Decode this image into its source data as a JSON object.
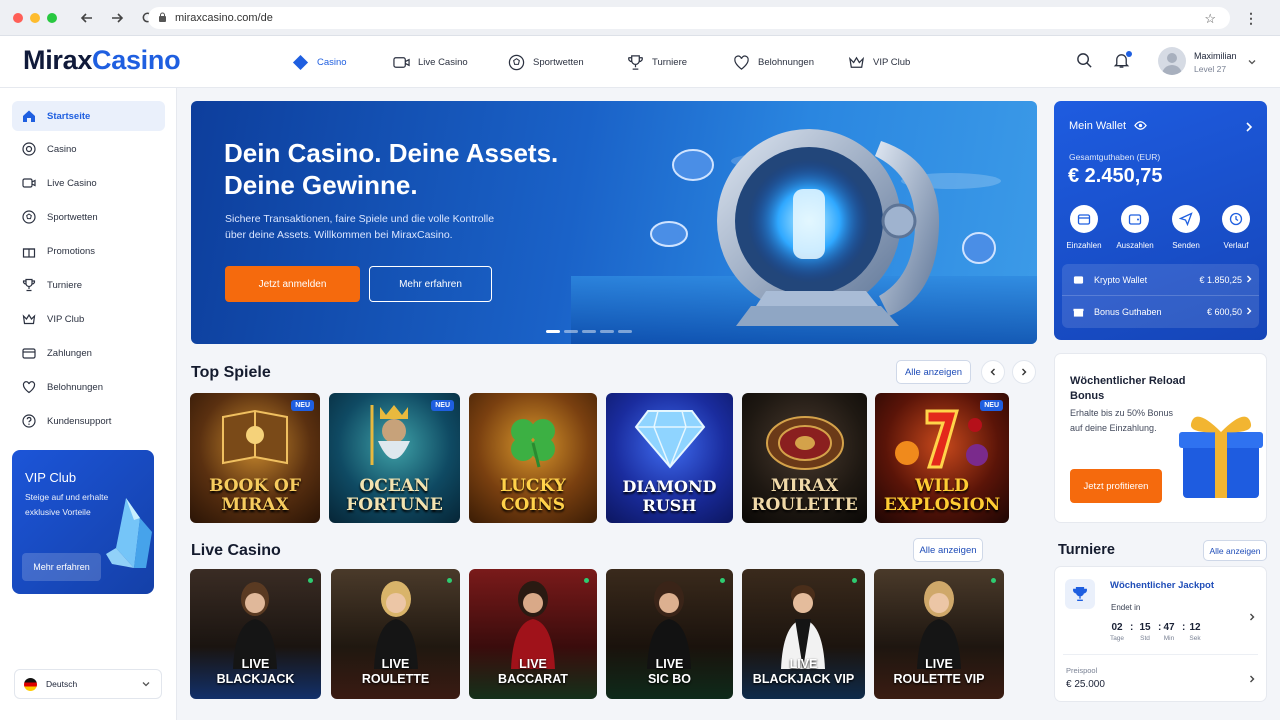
{
  "browser": {
    "url": "miraxcasino.com/de"
  },
  "brand": {
    "part1": "Mirax",
    "part2": "Casino"
  },
  "topnav": [
    {
      "label": "Casino",
      "icon": "casino-icon",
      "active": true
    },
    {
      "label": "Live Casino",
      "icon": "live-icon"
    },
    {
      "label": "Sportwetten",
      "icon": "ball-icon"
    },
    {
      "label": "Turniere",
      "icon": "trophy-icon"
    },
    {
      "label": "Belohnungen",
      "icon": "heart-icon"
    },
    {
      "label": "VIP Club",
      "icon": "crown-icon"
    }
  ],
  "user": {
    "name": "Maximilian",
    "level": "Level 27"
  },
  "sidebar": {
    "items": [
      {
        "label": "Startseite",
        "icon": "home-icon",
        "active": true
      },
      {
        "label": "Casino",
        "icon": "chip-icon"
      },
      {
        "label": "Live Casino",
        "icon": "live-icon"
      },
      {
        "label": "Sportwetten",
        "icon": "ball-icon"
      },
      {
        "label": "Promotions",
        "icon": "gift-icon"
      },
      {
        "label": "Turniere",
        "icon": "trophy-icon"
      },
      {
        "label": "VIP Club",
        "icon": "crown-icon"
      },
      {
        "label": "Zahlungen",
        "icon": "card-icon"
      },
      {
        "label": "Belohnungen",
        "icon": "heart-icon"
      },
      {
        "label": "Kundensupport",
        "icon": "help-icon"
      }
    ],
    "vip": {
      "title": "VIP Club",
      "text": "Steige auf und erhalte exklusive Vorteile",
      "button": "Mehr erfahren"
    },
    "language": "Deutsch"
  },
  "hero": {
    "title_line1": "Dein Casino. Deine Assets.",
    "title_line2": "Deine Gewinne.",
    "text": "Sichere Transaktionen, faire Spiele und die volle Kontrolle über deine Assets. Willkommen bei MiraxCasino.",
    "primary": "Jetzt anmelden",
    "secondary": "Mehr erfahren"
  },
  "top_games": {
    "title": "Top Spiele",
    "all": "Alle anzeigen",
    "games": [
      {
        "line1": "BOOK OF",
        "line2": "MIRAX",
        "badge": "NEU"
      },
      {
        "line1": "OCEAN",
        "line2": "FORTUNE",
        "badge": "NEU"
      },
      {
        "line1": "LUCKY",
        "line2": "COINS",
        "badge": ""
      },
      {
        "line1": "DIAMOND",
        "line2": "RUSH",
        "badge": ""
      },
      {
        "line1": "MIRAX",
        "line2": "ROULETTE",
        "badge": ""
      },
      {
        "line1": "WILD",
        "line2": "EXPLOSION",
        "badge": "NEU"
      }
    ]
  },
  "live_casino": {
    "title": "Live Casino",
    "all": "Alle anzeigen",
    "tables": [
      {
        "line1": "LIVE",
        "line2": "BLACKJACK"
      },
      {
        "line1": "LIVE",
        "line2": "ROULETTE"
      },
      {
        "line1": "LIVE",
        "line2": "BACCARAT"
      },
      {
        "line1": "LIVE",
        "line2": "SIC BO"
      },
      {
        "line1": "LIVE",
        "line2": "BLACKJACK VIP"
      },
      {
        "line1": "LIVE",
        "line2": "ROULETTE VIP"
      }
    ]
  },
  "wallet": {
    "title": "Mein Wallet",
    "balance_label": "Gesamtguthaben (EUR)",
    "balance": "€ 2.450,75",
    "actions": [
      "Einzahlen",
      "Auszahlen",
      "Senden",
      "Verlauf"
    ],
    "rows": [
      {
        "label": "Krypto Wallet",
        "amount": "€ 1.850,25"
      },
      {
        "label": "Bonus Guthaben",
        "amount": "€ 600,50"
      }
    ]
  },
  "promo": {
    "title": "Wöchentlicher Reload Bonus",
    "text": "Erhalte bis zu 50% Bonus auf deine Einzahlung.",
    "button": "Jetzt profitieren"
  },
  "tournaments": {
    "title": "Turniere",
    "all": "Alle anzeigen",
    "name": "Wöchentlicher Jackpot",
    "ends": "Endet in",
    "countdown": [
      {
        "n": "02",
        "u": "Tage"
      },
      {
        "n": "15",
        "u": "Std"
      },
      {
        "n": "47",
        "u": "Min"
      },
      {
        "n": "12",
        "u": "Sek"
      }
    ],
    "pool_label": "Preispool",
    "pool": "€ 25.000"
  },
  "colors": {
    "accent": "#1f5fe0",
    "orange": "#f56a0d",
    "navy": "#101a3a"
  }
}
